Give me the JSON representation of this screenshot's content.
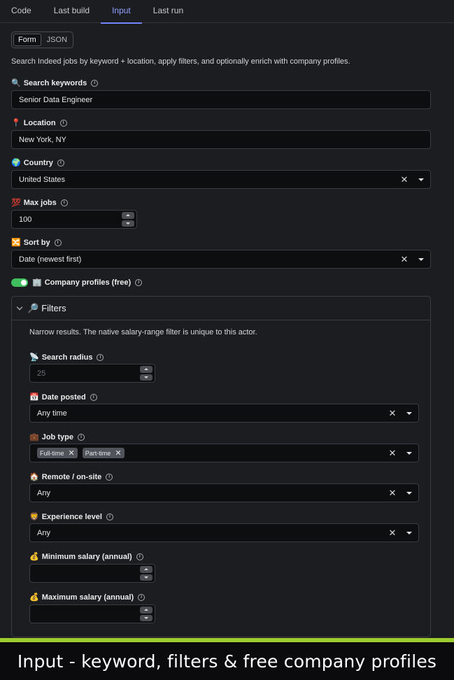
{
  "tabs": [
    {
      "label": "Code"
    },
    {
      "label": "Last build"
    },
    {
      "label": "Input"
    },
    {
      "label": "Last run"
    }
  ],
  "mode_toggle": {
    "form": "Form",
    "json": "JSON"
  },
  "description": "Search Indeed jobs by keyword + location, apply filters, and optionally enrich with company profiles.",
  "fields": {
    "search_keywords": {
      "emoji": "🔍",
      "label": "Search keywords",
      "value": "Senior Data Engineer"
    },
    "location": {
      "emoji": "📍",
      "label": "Location",
      "value": "New York, NY"
    },
    "country": {
      "emoji": "🌍",
      "label": "Country",
      "value": "United States"
    },
    "max_jobs": {
      "emoji": "💯",
      "label": "Max jobs",
      "value": "100"
    },
    "sort_by": {
      "emoji": "🔀",
      "label": "Sort by",
      "value": "Date (newest first)"
    },
    "company_profiles": {
      "emoji": "🏢",
      "label": "Company profiles (free)",
      "enabled": true
    }
  },
  "filters": {
    "emoji": "🔎",
    "title": "Filters",
    "description": "Narrow results. The native salary-range filter is unique to this actor.",
    "search_radius": {
      "emoji": "📡",
      "label": "Search radius",
      "placeholder": "25"
    },
    "date_posted": {
      "emoji": "📅",
      "label": "Date posted",
      "value": "Any time"
    },
    "job_type": {
      "emoji": "💼",
      "label": "Job type",
      "chips": [
        "Full-time",
        "Part-time"
      ]
    },
    "remote": {
      "emoji": "🏠",
      "label": "Remote / on-site",
      "value": "Any"
    },
    "experience": {
      "emoji": "🦁",
      "label": "Experience level",
      "value": "Any"
    },
    "min_salary": {
      "emoji": "💰",
      "label": "Minimum salary (annual)",
      "value": ""
    },
    "max_salary": {
      "emoji": "💰",
      "label": "Maximum salary (annual)",
      "value": ""
    }
  },
  "footer": {
    "caption": "Input - keyword, filters & free company profiles"
  },
  "colors": {
    "accent": "#6f86ff",
    "switch_on": "#3fbf5f",
    "footer_bar": "#9ccc2f"
  }
}
